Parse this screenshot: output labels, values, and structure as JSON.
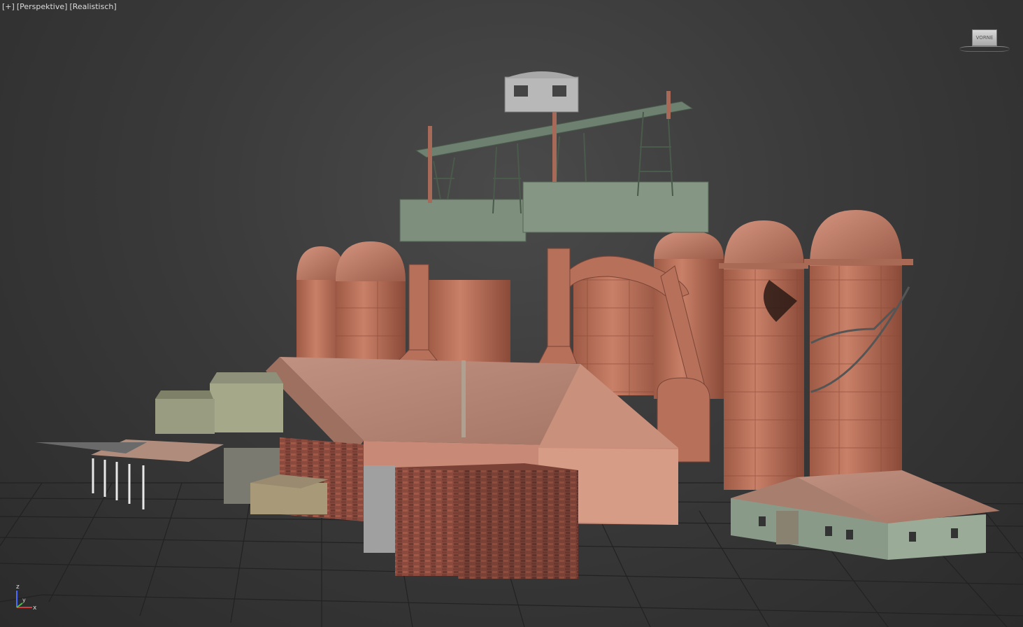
{
  "viewport": {
    "labels": [
      "[+]",
      "[Perspektive]",
      "[Realistisch]"
    ],
    "viewcube_label": "VORNE",
    "axes": {
      "x": "x",
      "y": "y",
      "z": "z"
    }
  },
  "colors": {
    "background": "#3a3a3a",
    "grid": "#222222",
    "silo": "#c07a62",
    "silo_dark": "#8e4f3c",
    "roof": "#b58a7a",
    "green_steel": "#7e8f7e",
    "brick": "#8b4a3e",
    "x_axis": "#d23c3c",
    "y_axis": "#4cc24c",
    "z_axis": "#4c6cff"
  }
}
